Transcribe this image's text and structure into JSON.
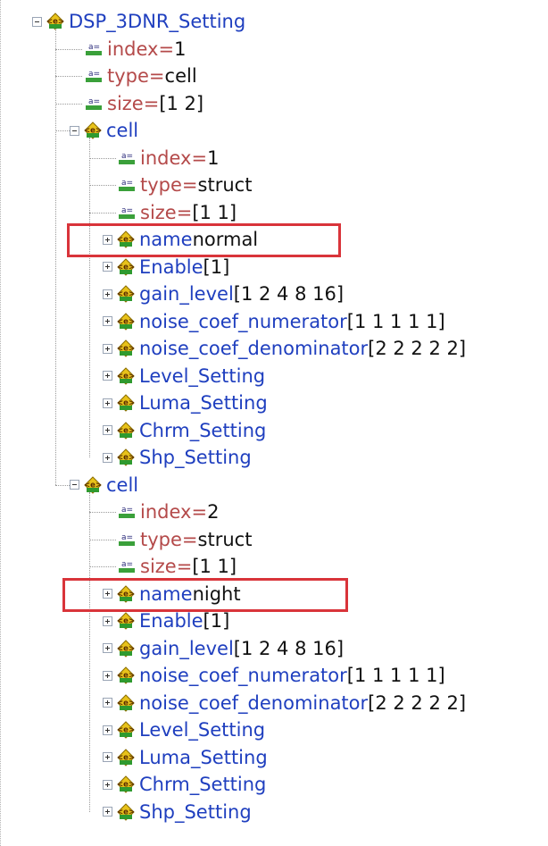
{
  "colors": {
    "node_label": "#1f3fbf",
    "field_label": "#b44a4a",
    "value_text": "#111111",
    "highlight_border": "#d9343a"
  },
  "icons": {
    "struct": "struct-node-icon",
    "field": "field-value-icon",
    "toggle_expanded": "collapse-minus-icon",
    "toggle_collapsed": "expand-plus-icon"
  },
  "tree": {
    "root": {
      "label": "DSP_3DNR_Setting"
    },
    "root_fields": [
      {
        "name": "index",
        "sep": " = ",
        "value": "1"
      },
      {
        "name": "type",
        "sep": " = ",
        "value": "cell"
      },
      {
        "name": "size",
        "sep": " = ",
        "value": "[1 2]"
      }
    ],
    "cells": [
      {
        "label": "cell",
        "fields": [
          {
            "name": "index",
            "sep": " = ",
            "value": "1"
          },
          {
            "name": "type",
            "sep": " = ",
            "value": "struct"
          },
          {
            "name": "size",
            "sep": " = ",
            "value": "[1 1]"
          }
        ],
        "children": [
          {
            "name": "name",
            "value": " normal"
          },
          {
            "name": "Enable",
            "value": " [1]"
          },
          {
            "name": "gain_level",
            "value": " [1 2 4 8 16]"
          },
          {
            "name": "noise_coef_numerator",
            "value": " [1 1 1 1 1]"
          },
          {
            "name": "noise_coef_denominator",
            "value": " [2 2 2 2 2]"
          },
          {
            "name": "Level_Setting",
            "value": ""
          },
          {
            "name": "Luma_Setting",
            "value": ""
          },
          {
            "name": "Chrm_Setting",
            "value": ""
          },
          {
            "name": "Shp_Setting",
            "value": ""
          }
        ]
      },
      {
        "label": "cell",
        "fields": [
          {
            "name": "index",
            "sep": " = ",
            "value": "2"
          },
          {
            "name": "type",
            "sep": " = ",
            "value": "struct"
          },
          {
            "name": "size",
            "sep": " = ",
            "value": "[1 1]"
          }
        ],
        "children": [
          {
            "name": "name",
            "value": " night"
          },
          {
            "name": "Enable",
            "value": " [1]"
          },
          {
            "name": "gain_level",
            "value": " [1 2 4 8 16]"
          },
          {
            "name": "noise_coef_numerator",
            "value": " [1 1 1 1 1]"
          },
          {
            "name": "noise_coef_denominator",
            "value": " [2 2 2 2 2]"
          },
          {
            "name": "Level_Setting",
            "value": ""
          },
          {
            "name": "Luma_Setting",
            "value": ""
          },
          {
            "name": "Chrm_Setting",
            "value": ""
          },
          {
            "name": "Shp_Setting",
            "value": ""
          }
        ]
      }
    ]
  }
}
